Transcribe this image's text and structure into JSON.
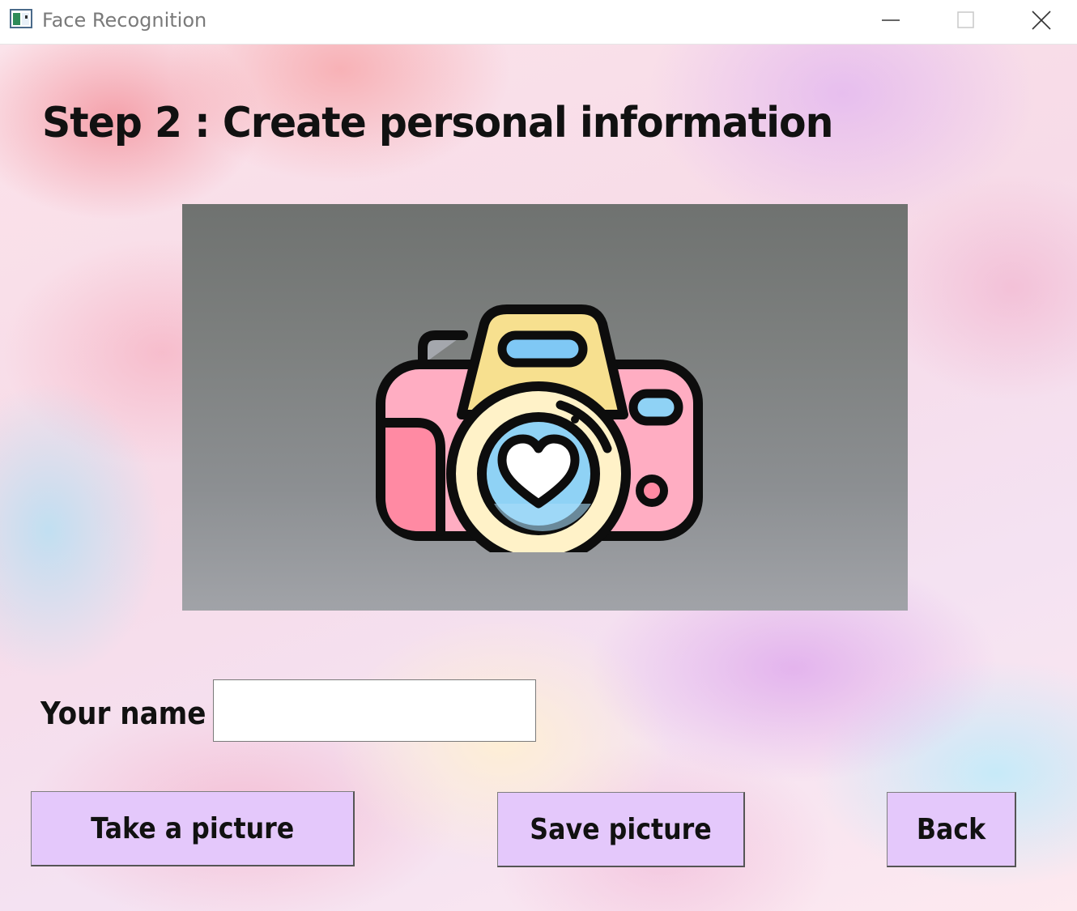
{
  "window": {
    "title": "Face Recognition",
    "controls": {
      "minimize_icon": "minimize-icon",
      "maximize_icon": "maximize-icon",
      "close_icon": "close-icon"
    }
  },
  "main": {
    "heading": "Step 2 : Create personal information",
    "preview": {
      "icon": "camera-heart-icon"
    },
    "name_field": {
      "label": "Your name :",
      "value": "",
      "placeholder": ""
    },
    "buttons": {
      "take_picture": "Take a picture",
      "save_picture": "Save picture",
      "back": "Back"
    }
  },
  "colors": {
    "button_bg": "#e4c8fb",
    "text": "#111111",
    "camera_body": "#ffadc2",
    "camera_grip": "#ff8aa3",
    "camera_top": "#f7e08f",
    "lens_blue": "#8fd2f5",
    "outline": "#0d0d0d"
  }
}
